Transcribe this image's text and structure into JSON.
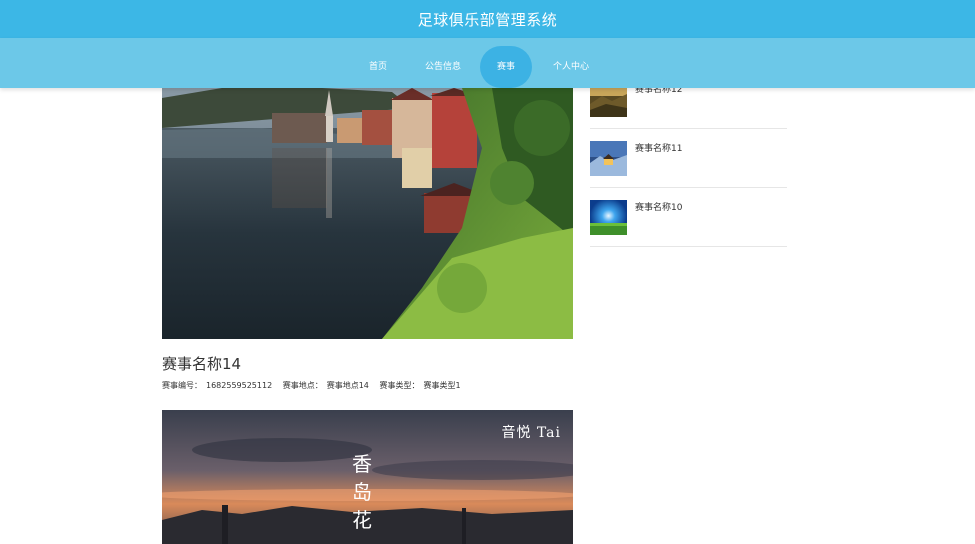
{
  "header": {
    "title": "足球俱乐部管理系统"
  },
  "nav": {
    "items": [
      {
        "label": "首页"
      },
      {
        "label": "公告信息"
      },
      {
        "label": "赛事"
      },
      {
        "label": "个人中心"
      }
    ],
    "active_index": 2
  },
  "main": {
    "card": {
      "title": "赛事名称14",
      "meta": {
        "code_label": "赛事编号：",
        "code_value": "1682559525112",
        "place_label": "赛事地点：",
        "place_value": "赛事地点14",
        "type_label": "赛事类型：",
        "type_value": "赛事类型1"
      }
    },
    "second_card_overlay": {
      "corner_text": "音悦 Tai",
      "vertical_text": "香\n岛\n花"
    }
  },
  "sidebar": {
    "items": [
      {
        "name": "赛事名称12"
      },
      {
        "name": "赛事名称11"
      },
      {
        "name": "赛事名称10"
      }
    ]
  }
}
